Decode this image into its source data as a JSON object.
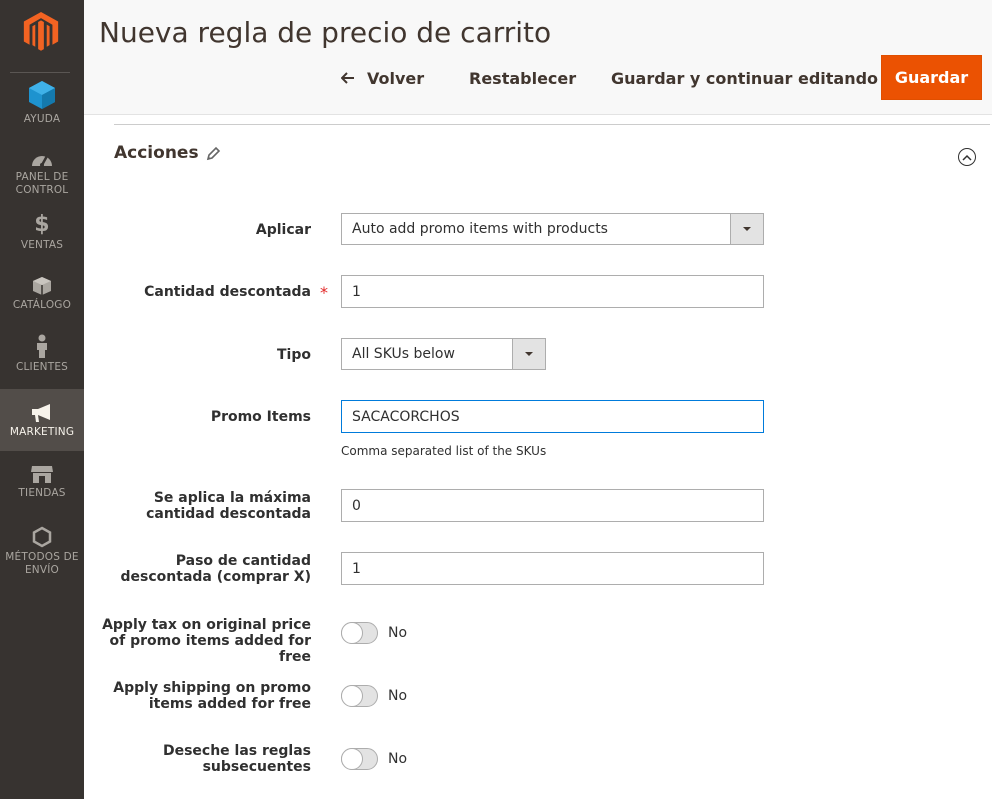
{
  "sidebar": {
    "items": [
      {
        "label": "AYUDA",
        "icon": "cube-icon"
      },
      {
        "label": "PANEL DE CONTROL",
        "icon": "dashboard-icon"
      },
      {
        "label": "VENTAS",
        "icon": "dollar-icon"
      },
      {
        "label": "CATÁLOGO",
        "icon": "box-icon"
      },
      {
        "label": "CLIENTES",
        "icon": "person-icon"
      },
      {
        "label": "MARKETING",
        "icon": "megaphone-icon"
      },
      {
        "label": "TIENDAS",
        "icon": "store-icon"
      },
      {
        "label": "MÉTODOS DE ENVÍO",
        "icon": "hexagon-icon"
      }
    ],
    "active": "MARKETING"
  },
  "header": {
    "title": "Nueva regla de precio de carrito",
    "back_label": "Volver",
    "reset_label": "Restablecer",
    "save_continue_label": "Guardar y continuar editando",
    "save_label": "Guardar"
  },
  "section": {
    "title": "Acciones"
  },
  "form": {
    "apply": {
      "label": "Aplicar",
      "value": "Auto add promo items with products"
    },
    "discount_qty": {
      "label": "Cantidad descontada",
      "value": "1",
      "required": "*"
    },
    "type": {
      "label": "Tipo",
      "value": "All SKUs below"
    },
    "promo_items": {
      "label": "Promo Items",
      "value": "SACACORCHOS",
      "note": "Comma separated list of the SKUs"
    },
    "max_qty": {
      "label": "Se aplica la máxima cantidad descontada",
      "value": "0"
    },
    "qty_step": {
      "label": "Paso de cantidad descontada (comprar X)",
      "value": "1"
    },
    "apply_tax": {
      "label": "Apply tax on original price of promo items added for free",
      "value": "No"
    },
    "apply_shipping": {
      "label": "Apply shipping on promo items added for free",
      "value": "No"
    },
    "discard_rules": {
      "label": "Deseche las reglas subsecuentes",
      "value": "No"
    }
  },
  "colors": {
    "sidebar_bg": "#373330",
    "accent": "#eb5202",
    "focus_border": "#007bdb"
  }
}
